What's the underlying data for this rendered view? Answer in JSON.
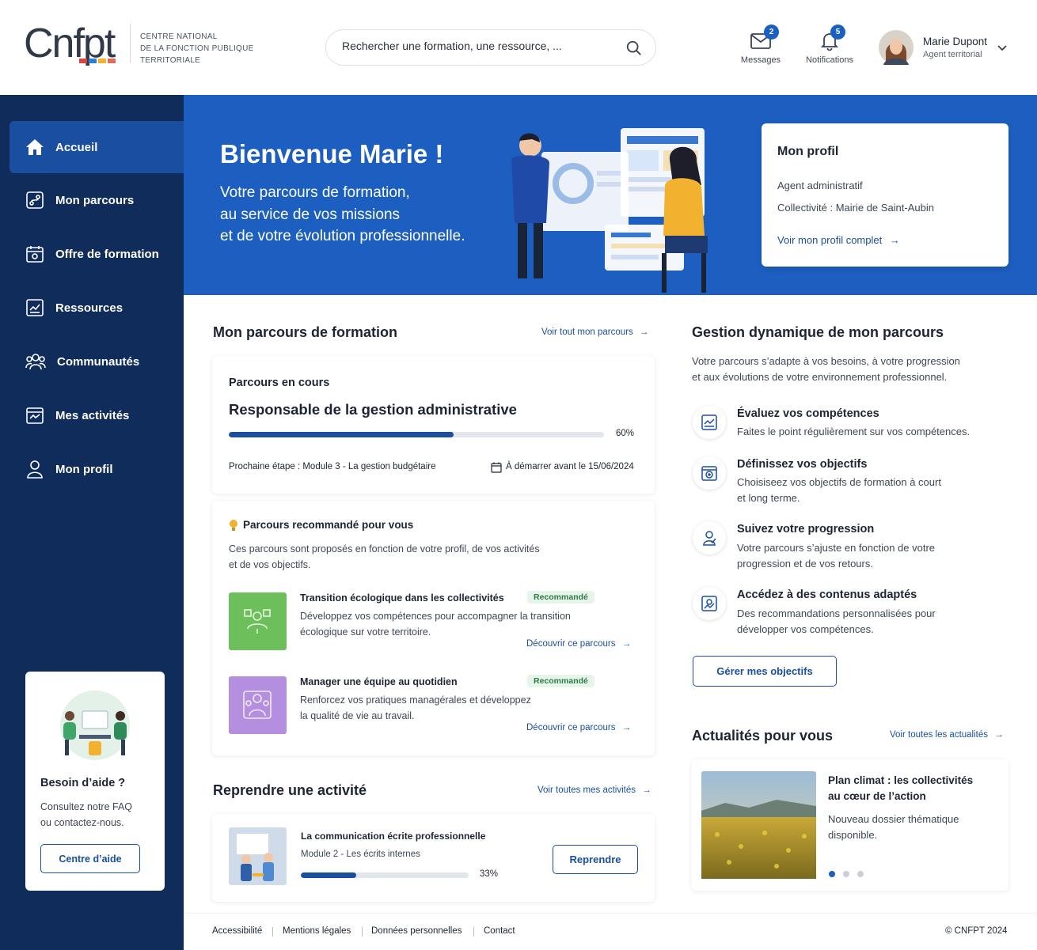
{
  "header": {
    "logo_text": "CNFPT",
    "logo_subtitle": [
      "CENTRE NATIONAL",
      "DE LA FONCTION PUBLIQUE",
      "TERRITORIALE"
    ],
    "search_placeholder": "Rechercher une formation, une ressource, ...",
    "messages_label": "Messages",
    "messages_count": "2",
    "notifications_label": "Notifications",
    "notifications_count": "5",
    "user_name": "Marie Dupont",
    "user_role": "Agent territorial"
  },
  "sidebar": {
    "items": [
      {
        "label": "Accueil",
        "icon": "home-icon",
        "active": true
      },
      {
        "label": "Mon parcours",
        "icon": "route-icon"
      },
      {
        "label": "Offre de formation",
        "icon": "calendar-icon"
      },
      {
        "label": "Ressources",
        "icon": "resources-icon"
      },
      {
        "label": "Communautés",
        "icon": "community-icon"
      },
      {
        "label": "Mes activités",
        "icon": "activity-icon"
      },
      {
        "label": "Mon profil",
        "icon": "user-icon"
      }
    ],
    "help": {
      "title": "Besoin d’aide ?",
      "desc_1": "Consultez notre FAQ",
      "desc_2": "ou contactez-nous.",
      "button": "Centre d’aide"
    }
  },
  "hero": {
    "title": "Bienvenue Marie !",
    "line_1": "Votre parcours de formation,",
    "line_2": "au service de vos missions",
    "line_3": "et de votre évolution professionnelle."
  },
  "profile_card": {
    "title": "Mon profil",
    "role": "Agent administratif",
    "collectivite": "Collectivité : Mairie de Saint-Aubin",
    "link": "Voir mon profil complet"
  },
  "parcours": {
    "title": "Mon parcours de formation",
    "link": "Voir tout mon parcours",
    "card_label": "Parcours en cours",
    "name": "Responsable de la gestion administrative",
    "progress": 60,
    "progress_text": "60%",
    "next_step": "Prochaine étape : Module 3 - La gestion budgétaire",
    "deadline": "À démarrer avant le 15/06/2024"
  },
  "recommended": {
    "title": "Parcours recommandé pour vous",
    "desc_1": "Ces parcours sont proposés en fonction de votre profil, de vos activités",
    "desc_2": "et de vos objectifs.",
    "items": [
      {
        "title": "Transition écologique dans les collectivités",
        "badge": "Recommandé",
        "desc_1": "Développez vos compétences pour accompagner la transition",
        "desc_2": "écologique sur votre territoire.",
        "link": "Découvrir ce parcours",
        "color": "#6cbf5a"
      },
      {
        "title": "Manager une équipe au quotidien",
        "badge": "Recommandé",
        "desc_1": "Renforcez vos pratiques managérales et développez",
        "desc_2": "la qualité de vie au travail.",
        "link": "Découvrir ce parcours",
        "color": "#b48fe0"
      }
    ]
  },
  "activity": {
    "title": "Reprendre une activité",
    "link": "Voir toutes mes activités",
    "name": "La communication écrite professionnelle",
    "module": "Module 2 - Les écrits internes",
    "progress": 33,
    "progress_text": "33%",
    "button": "Reprendre"
  },
  "gestion": {
    "title": "Gestion dynamique de mon parcours",
    "desc_1": "Votre parcours s’adapte à vos besoins, à votre progression",
    "desc_2": "et aux évolutions de votre environnement professionnel.",
    "features": [
      {
        "title": "Évaluez vos compétences",
        "desc_1": "Faites le point régulièrement sur vos compétences.",
        "desc_2": ""
      },
      {
        "title": "Définissez vos objectifs",
        "desc_1": "Choisiseez vos objectifs de formation à court",
        "desc_2": "et long terme."
      },
      {
        "title": "Suivez votre progression",
        "desc_1": "Votre parcours s’ajuste en fonction de votre",
        "desc_2": "progression et de vos retours."
      },
      {
        "title": "Accédez à des contenus adaptés",
        "desc_1": "Des recommandations personnalisées pour",
        "desc_2": "développer vos compétences."
      }
    ],
    "button": "Gérer mes objectifs"
  },
  "news": {
    "title": "Actualités pour vous",
    "link": "Voir toutes les actualités",
    "headline_1": "Plan climat : les collectivités",
    "headline_2": "au cœur de l’action",
    "desc_1": "Nouveau dossier thématique",
    "desc_2": "disponible."
  },
  "footer": {
    "links": [
      "Accessibilité",
      "Mentions légales",
      "Données personnelles",
      "Contact"
    ],
    "copyright": "© CNFPT 2024"
  },
  "colors": {
    "primary": "#1a4fa0",
    "sidebar": "#0f2c5a",
    "hero": "#1c5fc1",
    "badge_green": "#2e7d46"
  }
}
